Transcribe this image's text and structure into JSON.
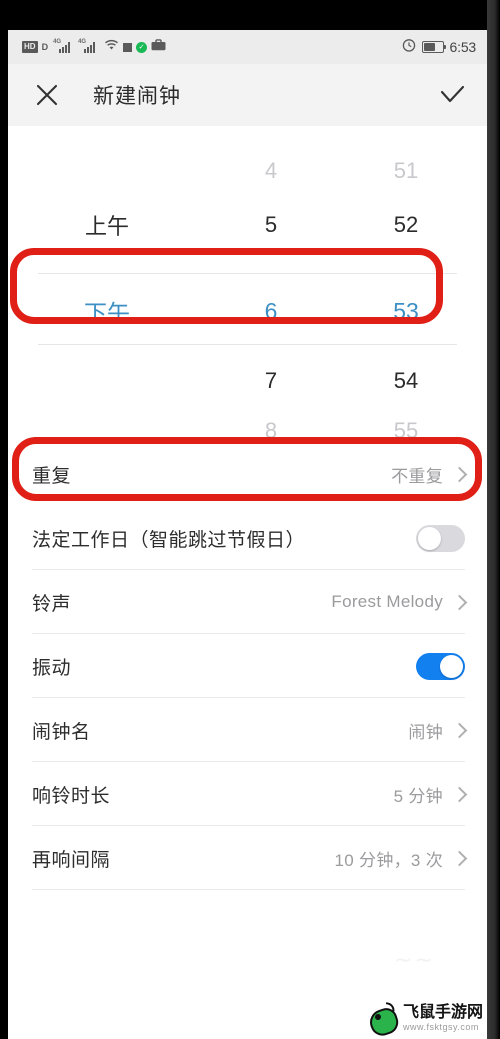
{
  "statusbar": {
    "hd_badge": "HD",
    "data_badge": "D",
    "network_label_1": "4G",
    "network_label_2": "4G",
    "icons": [
      "hd-icon",
      "data-icon",
      "signal-1-icon",
      "signal-2-icon",
      "wifi-icon",
      "square-icon",
      "green-check-icon",
      "briefcase-icon",
      "alarm-icon",
      "battery-icon"
    ],
    "time": "6:53"
  },
  "appbar": {
    "close_label": "✕",
    "title": "新建闹钟",
    "confirm_label": "✓"
  },
  "picker": {
    "rows": [
      {
        "ampm": "",
        "hour": "4",
        "minute": "51",
        "state": "far"
      },
      {
        "ampm": "上午",
        "hour": "5",
        "minute": "52",
        "state": "near"
      },
      {
        "ampm": "下午",
        "hour": "6",
        "minute": "53",
        "state": "selected"
      },
      {
        "ampm": "",
        "hour": "7",
        "minute": "54",
        "state": "near"
      },
      {
        "ampm": "",
        "hour": "8",
        "minute": "55",
        "state": "far"
      }
    ],
    "selected_ampm": "下午",
    "selected_hour": "6",
    "selected_minute": "53",
    "selected_color": "#3d8fc4"
  },
  "settings": {
    "rows": [
      {
        "label": "重复",
        "value": "不重复",
        "control": "chevron",
        "highlighted": true
      },
      {
        "label": "法定工作日（智能跳过节假日）",
        "value": "",
        "control": "toggle-off",
        "highlighted": false
      },
      {
        "label": "铃声",
        "value": "Forest Melody",
        "control": "chevron",
        "highlighted": false
      },
      {
        "label": "振动",
        "value": "",
        "control": "toggle-on",
        "highlighted": false
      },
      {
        "label": "闹钟名",
        "value": "闹钟",
        "control": "chevron",
        "highlighted": false
      },
      {
        "label": "响铃时长",
        "value": "5 分钟",
        "control": "chevron",
        "highlighted": false
      },
      {
        "label": "再响间隔",
        "value": "10 分钟，3 次",
        "control": "chevron",
        "highlighted": false
      }
    ]
  },
  "annotations": {
    "color": "#e01f16",
    "boxes": [
      "selected-time-row",
      "repeat-row"
    ]
  },
  "watermark": {
    "site_name": "飞鼠手游网",
    "url": "www.fsktgsy.com"
  },
  "colors": {
    "toggle_on": "#1380f0",
    "toggle_off": "#dadade",
    "accent_blue": "#3d8fc4",
    "annotation_red": "#e01f16"
  }
}
